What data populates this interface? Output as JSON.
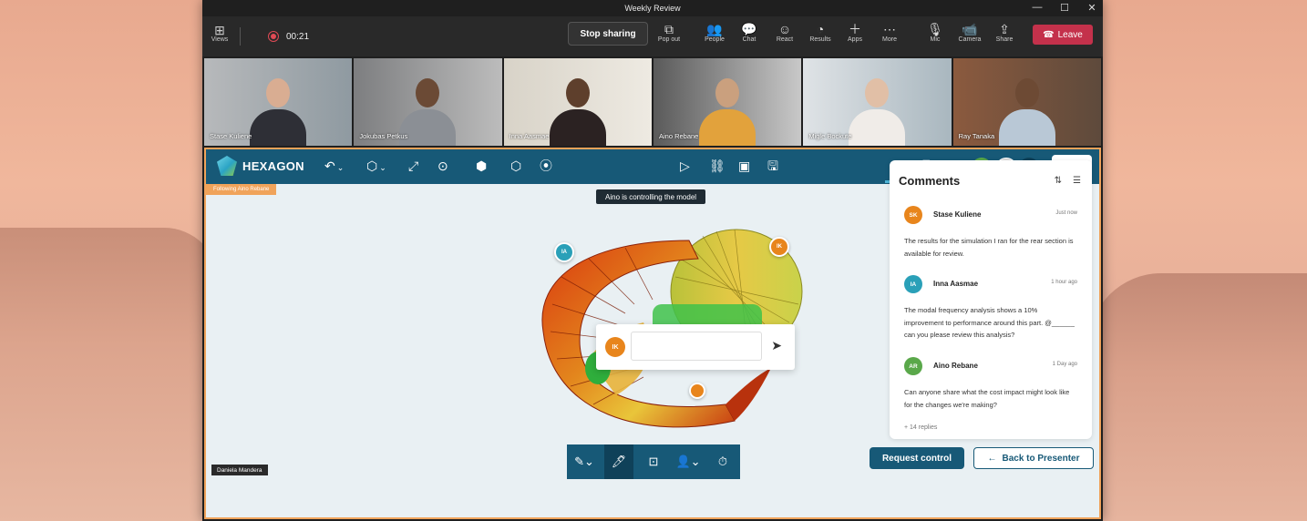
{
  "window": {
    "title": "Weekly Review"
  },
  "meeting_toolbar": {
    "views_label": "Views",
    "timer": "00:21",
    "stop_sharing": "Stop sharing",
    "buttons": [
      {
        "label": "Pop out",
        "icon": "pop-out-icon"
      },
      {
        "label": "People",
        "icon": "people-icon"
      },
      {
        "label": "Chat",
        "icon": "chat-icon"
      },
      {
        "label": "React",
        "icon": "react-icon"
      },
      {
        "label": "Results",
        "icon": "results-icon"
      },
      {
        "label": "Apps",
        "icon": "apps-icon"
      },
      {
        "label": "More",
        "icon": "more-icon"
      },
      {
        "label": "Mic",
        "icon": "mic-icon"
      },
      {
        "label": "Camera",
        "icon": "camera-icon"
      },
      {
        "label": "Share",
        "icon": "share-icon"
      }
    ],
    "leave": "Leave"
  },
  "participants": [
    {
      "name": "Stase Kuliene"
    },
    {
      "name": "Jokubas Petkus"
    },
    {
      "name": "Inna Aasmae"
    },
    {
      "name": "Aino Rebane"
    },
    {
      "name": "Migle Bockute"
    },
    {
      "name": "Ray Tanaka"
    }
  ],
  "app": {
    "brand": "HEXAGON",
    "avatar_initials": "AR",
    "more_count": "+2",
    "share": "Share",
    "following": "Following Aino Rebane",
    "control_tip": "Aino is controlling the model",
    "pins": {
      "ia": "IA",
      "ik": "IK"
    },
    "comment_input": {
      "avatar": "IK",
      "placeholder": ""
    },
    "presenter_tag": "Daniela Mandera",
    "request_control": "Request control",
    "back_to_presenter": "Back to Presenter"
  },
  "comments_panel": {
    "title": "Comments",
    "items": [
      {
        "initials": "SK",
        "name": "Stase Kuliene",
        "time": "Just now",
        "text": "The results for the simulation I ran for the rear section is available for review.",
        "color": "#e8851c"
      },
      {
        "initials": "IA",
        "name": "Inna Aasmae",
        "time": "1 hour ago",
        "text": "The modal frequency analysis shows a 10% improvement to performance around this part. @______ can you please review this analysis?",
        "color": "#2aa0b8"
      },
      {
        "initials": "AR",
        "name": "Aino Rebane",
        "time": "1 Day ago",
        "text": "Can anyone share what the cost impact might look like for the changes we're making?",
        "color": "#5aa84a"
      }
    ],
    "replies": "+ 14 replies"
  }
}
